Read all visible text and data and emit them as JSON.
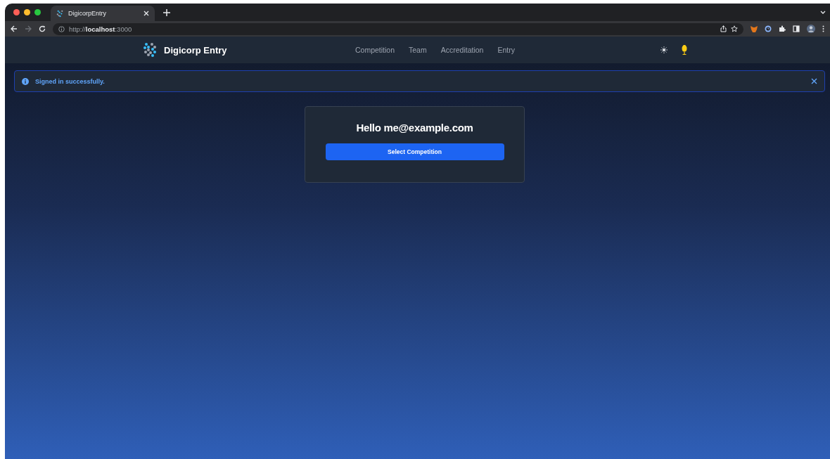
{
  "browser": {
    "tab_title": "DigicorpEntry",
    "url_scheme": "http://",
    "url_host": "localhost",
    "url_port": ":3000"
  },
  "navbar": {
    "brand": "Digicorp Entry",
    "links": [
      {
        "label": "Competition"
      },
      {
        "label": "Team"
      },
      {
        "label": "Accreditation"
      },
      {
        "label": "Entry"
      }
    ]
  },
  "alert": {
    "message": "Signed in successfully."
  },
  "card": {
    "greeting": "Hello me@example.com",
    "button": "Select Competition"
  }
}
